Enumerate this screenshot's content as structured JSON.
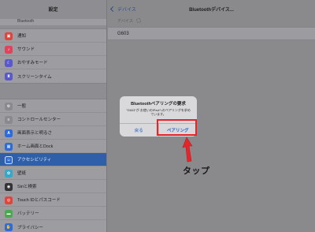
{
  "left": {
    "title": "設定",
    "partial_item": "Bluetooth",
    "group1": [
      {
        "label": "通知",
        "icon": "notifications-icon",
        "color": "#e0443a"
      },
      {
        "label": "サウンド",
        "icon": "sounds-icon",
        "color": "#e0445a"
      },
      {
        "label": "おやすみモード",
        "icon": "moon-icon",
        "color": "#5b58c9"
      },
      {
        "label": "スクリーンタイム",
        "icon": "hourglass-icon",
        "color": "#5b58c9"
      }
    ],
    "group2": [
      {
        "label": "一般",
        "icon": "gear-icon",
        "color": "#8a8a8e"
      },
      {
        "label": "コントロールセンター",
        "icon": "control-center-icon",
        "color": "#8a8a8e"
      },
      {
        "label": "画面表示と明るさ",
        "icon": "display-icon",
        "color": "#2e6bd8"
      },
      {
        "label": "ホーム画面とDock",
        "icon": "home-screen-icon",
        "color": "#2e6bd8"
      },
      {
        "label": "アクセシビリティ",
        "icon": "accessibility-icon",
        "color": "#2e6bd8",
        "selected": true
      },
      {
        "label": "壁紙",
        "icon": "wallpaper-icon",
        "color": "#35a7c9"
      },
      {
        "label": "Siriと検索",
        "icon": "siri-icon",
        "color": "#333336"
      },
      {
        "label": "Touch IDとパスコード",
        "icon": "fingerprint-icon",
        "color": "#e0443a"
      },
      {
        "label": "バッテリー",
        "icon": "battery-icon",
        "color": "#4aa94f"
      },
      {
        "label": "プライバシー",
        "icon": "hand-icon",
        "color": "#2e6bd8"
      }
    ]
  },
  "right": {
    "back_label": "デバイス",
    "title": "Bluetoothデバイス...",
    "section_label": "デバイス",
    "device_name": "G603"
  },
  "alert": {
    "title": "Bluetoothペアリングの要求",
    "message": "\"G603\"が お使いのiPadへのペアリングを求めています。",
    "cancel_label": "戻る",
    "pair_label": "ペアリング"
  },
  "annotation": {
    "tap_label": "タップ",
    "color": "#e5252b"
  }
}
